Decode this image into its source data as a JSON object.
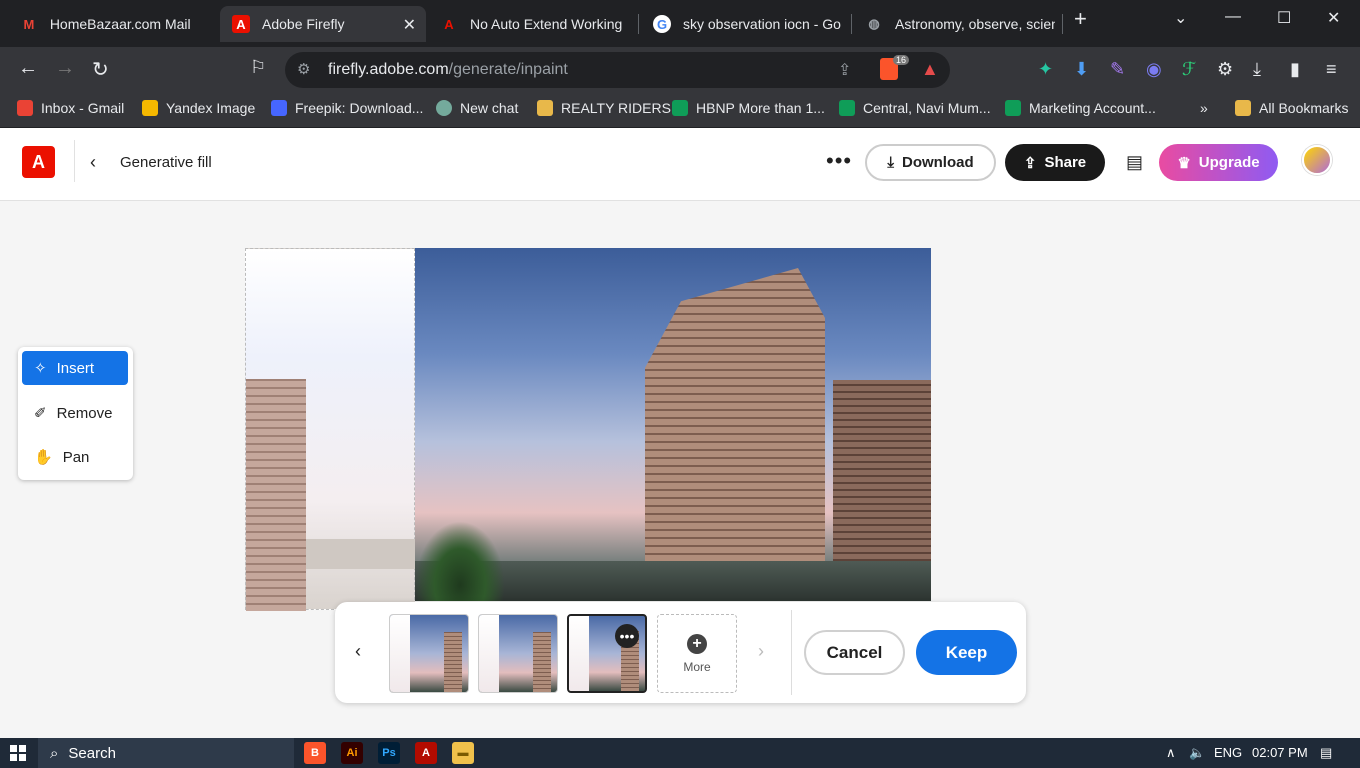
{
  "browser": {
    "tabs": [
      {
        "title": "HomeBazaar.com Mail",
        "active": false
      },
      {
        "title": "Adobe Firefly",
        "active": true
      },
      {
        "title": "No Auto Extend Working -",
        "active": false
      },
      {
        "title": "sky observation iocn - Goo",
        "active": false
      },
      {
        "title": "Astronomy, observe, scienc",
        "active": false
      }
    ],
    "url_host": "firefly.adobe.com",
    "url_path": "/generate/inpaint",
    "brave_badge": "16",
    "bookmarks": [
      {
        "label": "Inbox - Gmail",
        "color": "#ea4335"
      },
      {
        "label": "Yandex Image",
        "color": "#f5b800"
      },
      {
        "label": "Freepik: Download...",
        "color": "#4666ff"
      },
      {
        "label": "New chat",
        "color": "#74aa9c"
      },
      {
        "label": "REALTY RIDERS",
        "color": "#e8b84a"
      },
      {
        "label": "HBNP More than 1...",
        "color": "#0f9d58"
      },
      {
        "label": "Central, Navi Mum...",
        "color": "#0f9d58"
      },
      {
        "label": "Marketing Account...",
        "color": "#0f9d58"
      }
    ],
    "bookmarks_overflow": "»",
    "all_bookmarks": "All Bookmarks"
  },
  "app": {
    "logo_text": "A",
    "page_title": "Generative fill",
    "more_dots": "•••",
    "download_label": "Download",
    "share_label": "Share",
    "upgrade_label": "Upgrade",
    "accent": "#1473e6"
  },
  "tools": [
    {
      "label": "Insert",
      "icon": "sparkle-brush-icon",
      "active": true
    },
    {
      "label": "Remove",
      "icon": "eraser-icon",
      "active": false
    },
    {
      "label": "Pan",
      "icon": "hand-icon",
      "active": false
    }
  ],
  "variants": {
    "prev": "‹",
    "next": "›",
    "selected_index": 2,
    "thumb_dots": "•••",
    "more_label": "More",
    "more_plus": "+",
    "cancel_label": "Cancel",
    "keep_label": "Keep"
  },
  "taskbar": {
    "search_label": "Search",
    "language": "ENG",
    "time": "02:07 PM"
  }
}
